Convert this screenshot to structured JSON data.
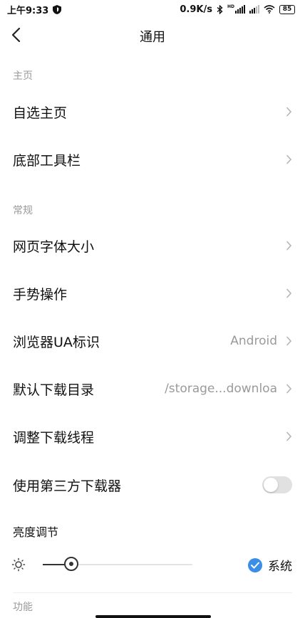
{
  "status": {
    "time": "上午9:33",
    "net_speed": "0.9K/s",
    "hd_label": "HD",
    "battery": "85"
  },
  "header": {
    "title": "通用"
  },
  "sections": {
    "home": "主页",
    "general": "常规",
    "features": "功能"
  },
  "rows": {
    "custom_home": "自选主页",
    "bottom_toolbar": "底部工具栏",
    "font_size": "网页字体大小",
    "gestures": "手势操作",
    "ua_label": "浏览器UA标识",
    "ua_value": "Android",
    "download_dir_label": "默认下载目录",
    "download_dir_value": "/storage...downloa",
    "download_threads": "调整下载线程",
    "third_party_dl": "使用第三方下载器"
  },
  "toggle": {
    "third_party_dl_on": false
  },
  "brightness": {
    "label": "亮度调节",
    "system_label": "系统",
    "system_checked": true,
    "level": 0.19
  },
  "colors": {
    "accent": "#3a8ee6",
    "muted_text": "#9a9a9a"
  }
}
